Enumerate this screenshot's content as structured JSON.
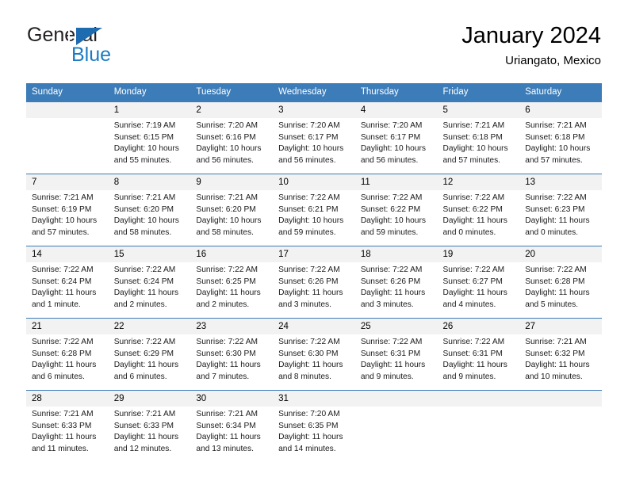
{
  "brand": {
    "name_top": "General",
    "name_bottom": "Blue",
    "triangle_color": "#1e6bb0",
    "blue_text_color": "#1b7ac4"
  },
  "header": {
    "title": "January 2024",
    "subtitle": "Uriangato, Mexico"
  },
  "theme": {
    "header_bg": "#3c7cb8",
    "header_text": "#ffffff",
    "daynum_bg": "#f2f2f2",
    "cell_bg": "#ffffff",
    "grid_line": "#3c7cb8"
  },
  "weekdays": [
    "Sunday",
    "Monday",
    "Tuesday",
    "Wednesday",
    "Thursday",
    "Friday",
    "Saturday"
  ],
  "weeks": [
    [
      {
        "day": "",
        "sunrise": "",
        "sunset": "",
        "daylight_line1": "",
        "daylight_line2": ""
      },
      {
        "day": "1",
        "sunrise": "Sunrise: 7:19 AM",
        "sunset": "Sunset: 6:15 PM",
        "daylight_line1": "Daylight: 10 hours",
        "daylight_line2": "and 55 minutes."
      },
      {
        "day": "2",
        "sunrise": "Sunrise: 7:20 AM",
        "sunset": "Sunset: 6:16 PM",
        "daylight_line1": "Daylight: 10 hours",
        "daylight_line2": "and 56 minutes."
      },
      {
        "day": "3",
        "sunrise": "Sunrise: 7:20 AM",
        "sunset": "Sunset: 6:17 PM",
        "daylight_line1": "Daylight: 10 hours",
        "daylight_line2": "and 56 minutes."
      },
      {
        "day": "4",
        "sunrise": "Sunrise: 7:20 AM",
        "sunset": "Sunset: 6:17 PM",
        "daylight_line1": "Daylight: 10 hours",
        "daylight_line2": "and 56 minutes."
      },
      {
        "day": "5",
        "sunrise": "Sunrise: 7:21 AM",
        "sunset": "Sunset: 6:18 PM",
        "daylight_line1": "Daylight: 10 hours",
        "daylight_line2": "and 57 minutes."
      },
      {
        "day": "6",
        "sunrise": "Sunrise: 7:21 AM",
        "sunset": "Sunset: 6:18 PM",
        "daylight_line1": "Daylight: 10 hours",
        "daylight_line2": "and 57 minutes."
      }
    ],
    [
      {
        "day": "7",
        "sunrise": "Sunrise: 7:21 AM",
        "sunset": "Sunset: 6:19 PM",
        "daylight_line1": "Daylight: 10 hours",
        "daylight_line2": "and 57 minutes."
      },
      {
        "day": "8",
        "sunrise": "Sunrise: 7:21 AM",
        "sunset": "Sunset: 6:20 PM",
        "daylight_line1": "Daylight: 10 hours",
        "daylight_line2": "and 58 minutes."
      },
      {
        "day": "9",
        "sunrise": "Sunrise: 7:21 AM",
        "sunset": "Sunset: 6:20 PM",
        "daylight_line1": "Daylight: 10 hours",
        "daylight_line2": "and 58 minutes."
      },
      {
        "day": "10",
        "sunrise": "Sunrise: 7:22 AM",
        "sunset": "Sunset: 6:21 PM",
        "daylight_line1": "Daylight: 10 hours",
        "daylight_line2": "and 59 minutes."
      },
      {
        "day": "11",
        "sunrise": "Sunrise: 7:22 AM",
        "sunset": "Sunset: 6:22 PM",
        "daylight_line1": "Daylight: 10 hours",
        "daylight_line2": "and 59 minutes."
      },
      {
        "day": "12",
        "sunrise": "Sunrise: 7:22 AM",
        "sunset": "Sunset: 6:22 PM",
        "daylight_line1": "Daylight: 11 hours",
        "daylight_line2": "and 0 minutes."
      },
      {
        "day": "13",
        "sunrise": "Sunrise: 7:22 AM",
        "sunset": "Sunset: 6:23 PM",
        "daylight_line1": "Daylight: 11 hours",
        "daylight_line2": "and 0 minutes."
      }
    ],
    [
      {
        "day": "14",
        "sunrise": "Sunrise: 7:22 AM",
        "sunset": "Sunset: 6:24 PM",
        "daylight_line1": "Daylight: 11 hours",
        "daylight_line2": "and 1 minute."
      },
      {
        "day": "15",
        "sunrise": "Sunrise: 7:22 AM",
        "sunset": "Sunset: 6:24 PM",
        "daylight_line1": "Daylight: 11 hours",
        "daylight_line2": "and 2 minutes."
      },
      {
        "day": "16",
        "sunrise": "Sunrise: 7:22 AM",
        "sunset": "Sunset: 6:25 PM",
        "daylight_line1": "Daylight: 11 hours",
        "daylight_line2": "and 2 minutes."
      },
      {
        "day": "17",
        "sunrise": "Sunrise: 7:22 AM",
        "sunset": "Sunset: 6:26 PM",
        "daylight_line1": "Daylight: 11 hours",
        "daylight_line2": "and 3 minutes."
      },
      {
        "day": "18",
        "sunrise": "Sunrise: 7:22 AM",
        "sunset": "Sunset: 6:26 PM",
        "daylight_line1": "Daylight: 11 hours",
        "daylight_line2": "and 3 minutes."
      },
      {
        "day": "19",
        "sunrise": "Sunrise: 7:22 AM",
        "sunset": "Sunset: 6:27 PM",
        "daylight_line1": "Daylight: 11 hours",
        "daylight_line2": "and 4 minutes."
      },
      {
        "day": "20",
        "sunrise": "Sunrise: 7:22 AM",
        "sunset": "Sunset: 6:28 PM",
        "daylight_line1": "Daylight: 11 hours",
        "daylight_line2": "and 5 minutes."
      }
    ],
    [
      {
        "day": "21",
        "sunrise": "Sunrise: 7:22 AM",
        "sunset": "Sunset: 6:28 PM",
        "daylight_line1": "Daylight: 11 hours",
        "daylight_line2": "and 6 minutes."
      },
      {
        "day": "22",
        "sunrise": "Sunrise: 7:22 AM",
        "sunset": "Sunset: 6:29 PM",
        "daylight_line1": "Daylight: 11 hours",
        "daylight_line2": "and 6 minutes."
      },
      {
        "day": "23",
        "sunrise": "Sunrise: 7:22 AM",
        "sunset": "Sunset: 6:30 PM",
        "daylight_line1": "Daylight: 11 hours",
        "daylight_line2": "and 7 minutes."
      },
      {
        "day": "24",
        "sunrise": "Sunrise: 7:22 AM",
        "sunset": "Sunset: 6:30 PM",
        "daylight_line1": "Daylight: 11 hours",
        "daylight_line2": "and 8 minutes."
      },
      {
        "day": "25",
        "sunrise": "Sunrise: 7:22 AM",
        "sunset": "Sunset: 6:31 PM",
        "daylight_line1": "Daylight: 11 hours",
        "daylight_line2": "and 9 minutes."
      },
      {
        "day": "26",
        "sunrise": "Sunrise: 7:22 AM",
        "sunset": "Sunset: 6:31 PM",
        "daylight_line1": "Daylight: 11 hours",
        "daylight_line2": "and 9 minutes."
      },
      {
        "day": "27",
        "sunrise": "Sunrise: 7:21 AM",
        "sunset": "Sunset: 6:32 PM",
        "daylight_line1": "Daylight: 11 hours",
        "daylight_line2": "and 10 minutes."
      }
    ],
    [
      {
        "day": "28",
        "sunrise": "Sunrise: 7:21 AM",
        "sunset": "Sunset: 6:33 PM",
        "daylight_line1": "Daylight: 11 hours",
        "daylight_line2": "and 11 minutes."
      },
      {
        "day": "29",
        "sunrise": "Sunrise: 7:21 AM",
        "sunset": "Sunset: 6:33 PM",
        "daylight_line1": "Daylight: 11 hours",
        "daylight_line2": "and 12 minutes."
      },
      {
        "day": "30",
        "sunrise": "Sunrise: 7:21 AM",
        "sunset": "Sunset: 6:34 PM",
        "daylight_line1": "Daylight: 11 hours",
        "daylight_line2": "and 13 minutes."
      },
      {
        "day": "31",
        "sunrise": "Sunrise: 7:20 AM",
        "sunset": "Sunset: 6:35 PM",
        "daylight_line1": "Daylight: 11 hours",
        "daylight_line2": "and 14 minutes."
      },
      {
        "day": "",
        "sunrise": "",
        "sunset": "",
        "daylight_line1": "",
        "daylight_line2": ""
      },
      {
        "day": "",
        "sunrise": "",
        "sunset": "",
        "daylight_line1": "",
        "daylight_line2": ""
      },
      {
        "day": "",
        "sunrise": "",
        "sunset": "",
        "daylight_line1": "",
        "daylight_line2": ""
      }
    ]
  ]
}
